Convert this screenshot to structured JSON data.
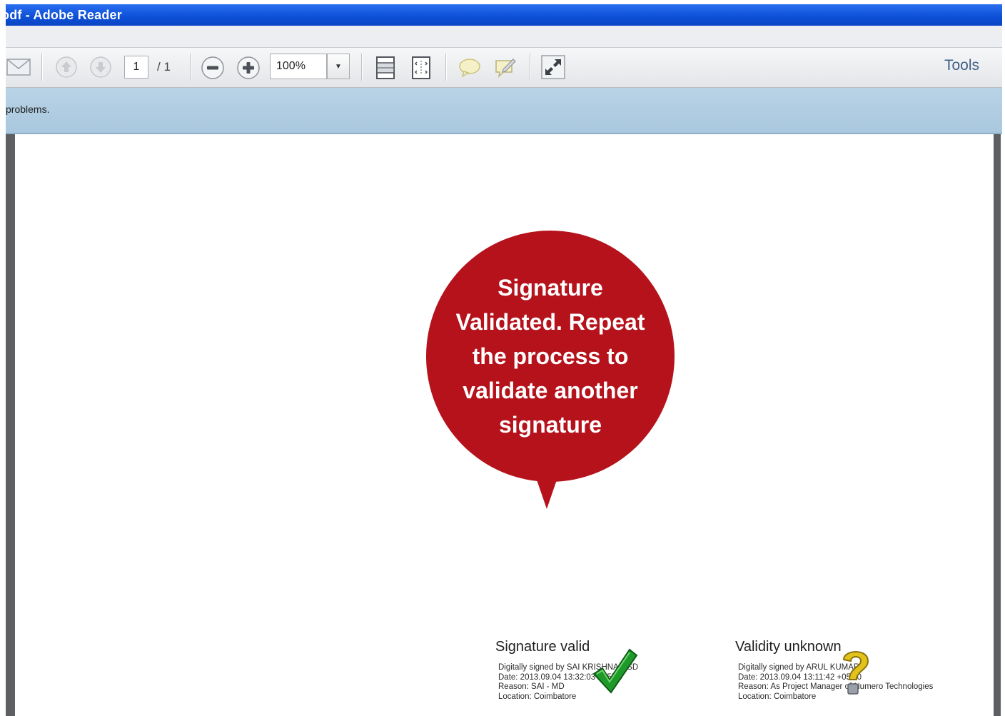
{
  "window": {
    "title": "odf - Adobe Reader"
  },
  "toolbar": {
    "current_page": "1",
    "page_total": "/ 1",
    "zoom": "100%",
    "tools_label": "Tools"
  },
  "message_bar": {
    "text": "problems."
  },
  "callout": {
    "text": "Signature\nValidated. Repeat\nthe process to\nvalidate another\nsignature"
  },
  "signatures": [
    {
      "status": "Signature valid",
      "status_icon": "green-checkmark-icon",
      "details": [
        "Digitally signed by SAI KRISHNAN SD",
        "Date: 2013.09.04 13:32:03 +05'30",
        "Reason: SAI - MD",
        "Location: Coimbatore"
      ]
    },
    {
      "status": "Validity unknown",
      "status_icon": "question-mark-icon",
      "details": [
        "Digitally signed by ARUL KUMAR",
        "Date: 2013.09.04 13:11:42 +05'30",
        "Reason: As Project Manager of Numero Technologies",
        "Location: Coimbatore"
      ]
    }
  ],
  "colors": {
    "title_bar": "#0d4fd6",
    "message_bar": "#b9d3e6",
    "callout": "#b5121b",
    "valid_check": "#1f9a2a",
    "unknown_question": "#e3c21a"
  }
}
